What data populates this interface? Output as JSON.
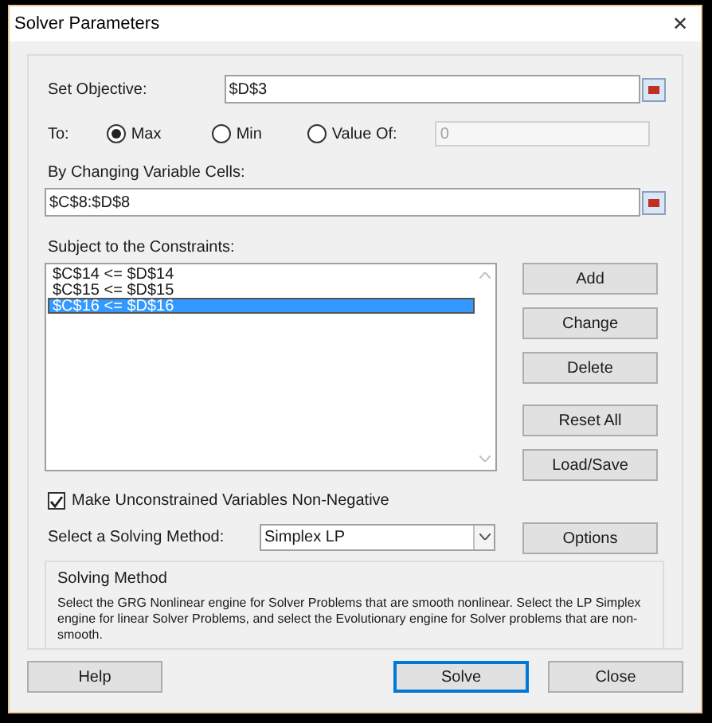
{
  "window": {
    "title": "Solver Parameters",
    "close": "✕"
  },
  "objective": {
    "label": "Set Objective:",
    "value": "$D$3"
  },
  "to": {
    "label": "To:",
    "options": [
      {
        "label": "Max",
        "selected": true
      },
      {
        "label": "Min",
        "selected": false
      },
      {
        "label": "Value Of:",
        "selected": false
      }
    ],
    "value_field": "0"
  },
  "variable_cells": {
    "label": "By Changing Variable Cells:",
    "value": "$C$8:$D$8"
  },
  "constraints": {
    "label": "Subject to the Constraints:",
    "items": [
      {
        "text": "$C$14 <= $D$14",
        "selected": false
      },
      {
        "text": "$C$15 <= $D$15",
        "selected": false
      },
      {
        "text": "$C$16 <= $D$16",
        "selected": true
      }
    ],
    "buttons": [
      "Add",
      "Change",
      "Delete",
      "Reset All",
      "Load/Save"
    ]
  },
  "non_negative": {
    "label": "Make Unconstrained Variables Non-Negative",
    "checked": true
  },
  "method": {
    "label": "Select a Solving Method:",
    "value": "Simplex LP",
    "options_button": "Options"
  },
  "method_info": {
    "title": "Solving Method",
    "text": "Select the GRG Nonlinear engine for Solver Problems that are smooth nonlinear. Select the LP Simplex engine for linear Solver Problems, and select the Evolutionary engine for Solver problems that are non-smooth."
  },
  "footer": [
    {
      "label": "Help",
      "default": false
    },
    {
      "label": "Solve",
      "default": true
    },
    {
      "label": "Close",
      "default": false
    }
  ]
}
